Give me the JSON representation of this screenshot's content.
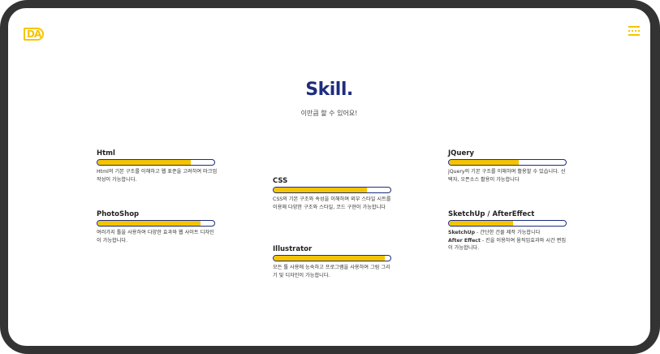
{
  "header": {
    "logo_text": "DA"
  },
  "hero": {
    "title": "Skill.",
    "subtitle": "이만큼 할 수 있어요!"
  },
  "skills": [
    {
      "name": "Html",
      "level": 0.8,
      "desc": "Html의 기본 구조를 이해하고 웹 표준을 고려하여 마크업 작성이 가능합니다."
    },
    {
      "name": "CSS",
      "level": 0.8,
      "desc": "CSS의 기본 구조와 속성을 이해하며 외부 스타일 시트를 이용해 다양한 구조와 스타일, 코드 구현이 가능합니다"
    },
    {
      "name": "Illustrator",
      "level": 0.95,
      "desc": "모든 툴 사용에 능숙하고 프로그램을 사용하여 그림 그리기 및 디자인이 가능합니다."
    },
    {
      "name": "PhotoShop",
      "level": 0.88,
      "desc": "여러가지 툴을 사용하여 다양한 효과와 웹 사이트 디자인이 가능합니다."
    },
    {
      "name": "JQuery",
      "level": 0.6,
      "desc": "jQuery의 기본 구조를 이해하며 활용할 수 있습니다. 선택자, 오픈소스 활용이 가능합니다"
    },
    {
      "name": "SketchUp / AfterEffect",
      "level": 0.55,
      "desc_line1_bold": "SketchUp",
      "desc_line1": " - 간단한 건물 제작 가능합니다",
      "desc_line2_bold": "After Effect",
      "desc_line2": " - 킨을 이용하여 움직임효과와 시간 편집이 가능합니다."
    }
  ],
  "colors": {
    "accent": "#f5c400",
    "navy": "#1e2d7d",
    "frame": "#333333"
  },
  "icons": {
    "menu": "hamburger-icon",
    "logo": "da-logo-icon"
  }
}
